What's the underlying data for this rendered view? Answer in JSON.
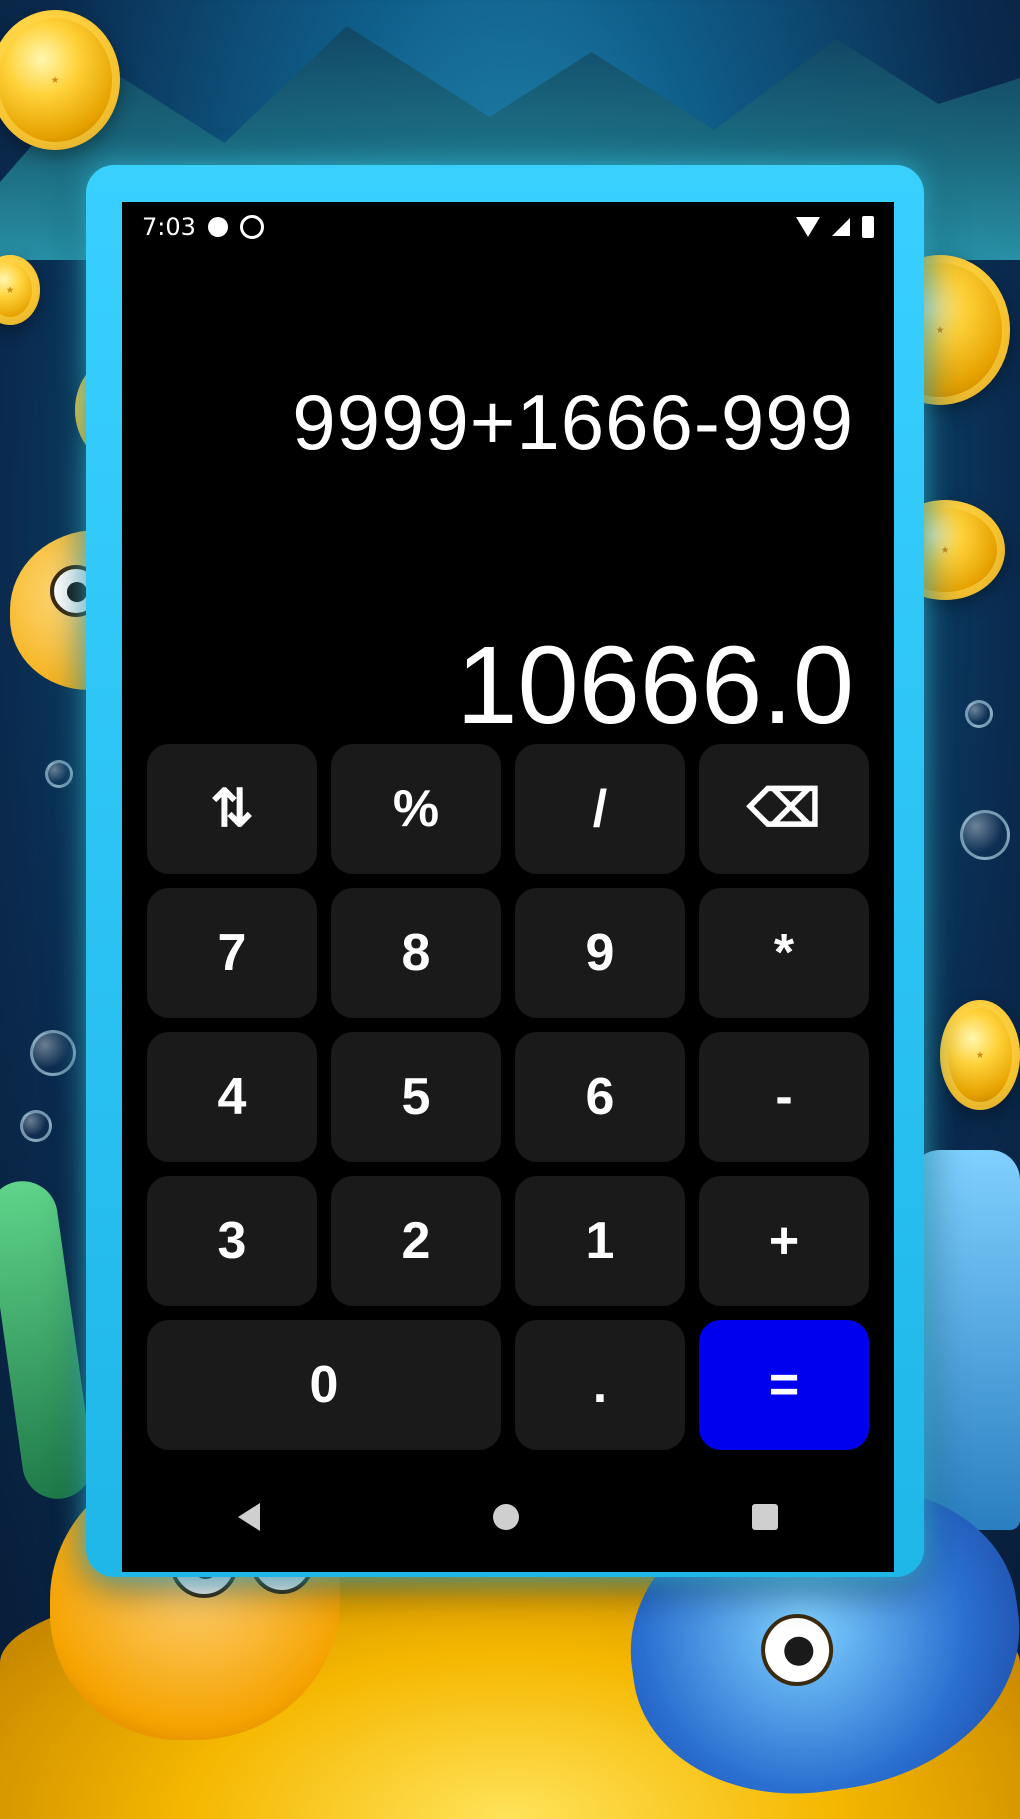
{
  "status_bar": {
    "time": "7:03"
  },
  "calculator": {
    "expression": "9999+1666-999",
    "result": "10666.0",
    "keys": [
      {
        "label": "⇅",
        "name": "swap-key"
      },
      {
        "label": "%",
        "name": "percent-key"
      },
      {
        "label": "/",
        "name": "divide-key"
      },
      {
        "label": "⌫",
        "name": "backspace-key"
      },
      {
        "label": "7",
        "name": "digit-7-key"
      },
      {
        "label": "8",
        "name": "digit-8-key"
      },
      {
        "label": "9",
        "name": "digit-9-key"
      },
      {
        "label": "*",
        "name": "multiply-key"
      },
      {
        "label": "4",
        "name": "digit-4-key"
      },
      {
        "label": "5",
        "name": "digit-5-key"
      },
      {
        "label": "6",
        "name": "digit-6-key"
      },
      {
        "label": "-",
        "name": "minus-key"
      },
      {
        "label": "3",
        "name": "digit-3-key"
      },
      {
        "label": "2",
        "name": "digit-2-key"
      },
      {
        "label": "1",
        "name": "digit-1-key"
      },
      {
        "label": "+",
        "name": "plus-key"
      },
      {
        "label": "0",
        "name": "digit-0-key"
      },
      {
        "label": ".",
        "name": "decimal-key"
      },
      {
        "label": "=",
        "name": "equals-key"
      }
    ]
  },
  "colors": {
    "screen_background": "#000000",
    "key_background": "#1a1a1a",
    "equals_background": "#0000ee",
    "phone_frame": "#39d0ff"
  },
  "icons": {
    "swap": "swap-vert-icon",
    "backspace": "backspace-icon",
    "wifi": "wifi-icon",
    "signal": "signal-icon",
    "battery": "battery-icon",
    "nav_back": "nav-back-icon",
    "nav_home": "nav-home-icon",
    "nav_recent": "nav-recent-icon"
  }
}
